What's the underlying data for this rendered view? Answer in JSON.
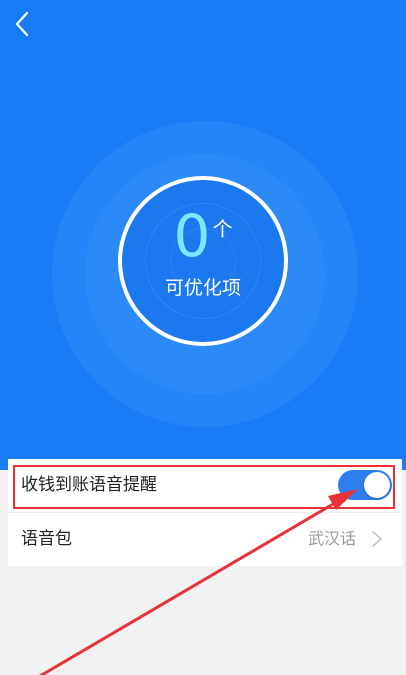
{
  "header": {
    "back_icon": "chevron-left-icon"
  },
  "summary": {
    "count": "0",
    "unit": "个",
    "caption": "可优化项"
  },
  "settings": {
    "voice_alert": {
      "label": "收钱到账语音提醒",
      "enabled": true
    },
    "voice_pack": {
      "label": "语音包",
      "value": "武汉话",
      "icon": "chevron-right-icon"
    }
  },
  "colors": {
    "hero_background": "#1a7cf5",
    "count_number": "#7de6ff",
    "toggle_on": "#2d7ff0",
    "annotation_red": "#e8323a"
  }
}
